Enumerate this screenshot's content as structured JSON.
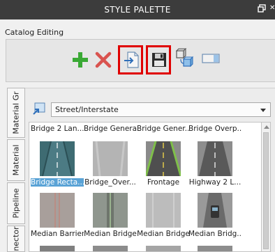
{
  "window": {
    "title": "STYLE PALETTE",
    "restore_icon": "restore-icon",
    "close_icon": "close-icon"
  },
  "catalog": {
    "label": "Catalog Editing"
  },
  "toolbar": {
    "buttons": [
      {
        "name": "add-button",
        "icon": "plus-icon",
        "color": "#3aa935"
      },
      {
        "name": "delete-button",
        "icon": "x-icon",
        "color": "#d9534f"
      },
      {
        "name": "import-button",
        "icon": "import-file-icon",
        "highlighted": true
      },
      {
        "name": "save-button",
        "icon": "floppy-disk-icon",
        "highlighted": true
      },
      {
        "name": "copy-style-button",
        "icon": "copy-cubes-icon"
      },
      {
        "name": "window-button",
        "icon": "window-icon"
      }
    ],
    "highlight_color": "#e00000"
  },
  "side_tabs": [
    {
      "label": "Material Gr"
    },
    {
      "label": "Material"
    },
    {
      "label": "Pipeline"
    },
    {
      "label": "nector"
    }
  ],
  "category": {
    "selected": "Street/Interstate"
  },
  "gallery": {
    "top_row_labels": [
      "Bridge 2 Lan...",
      "Bridge General",
      "Bridge Gener...",
      "Bridge Overp..."
    ],
    "row1": [
      {
        "label": "Bridge Recta...",
        "selected": true
      },
      {
        "label": "Bridge_Over..."
      },
      {
        "label": "Frontage"
      },
      {
        "label": "Highway 2 L..."
      }
    ],
    "row2": [
      {
        "label": "Median Barrier"
      },
      {
        "label": "Median Bridge"
      },
      {
        "label": "Median Bridge"
      },
      {
        "label": "Median Bridg..."
      }
    ]
  }
}
